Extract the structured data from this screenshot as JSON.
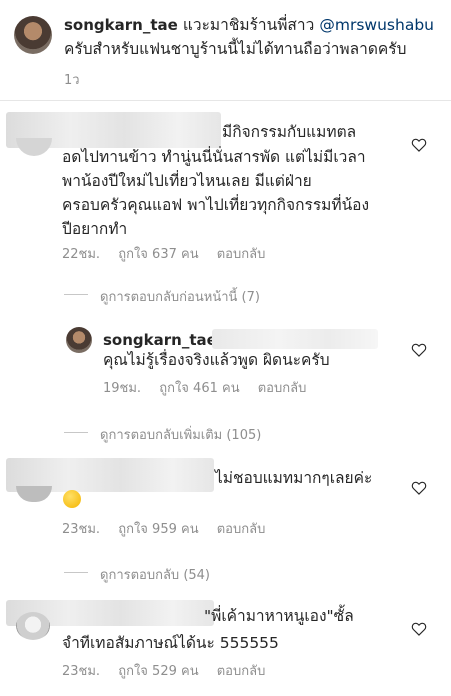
{
  "post": {
    "username": "songkarn_tae",
    "line1_prefix": "แวะมาชิมร้านพี่สาว",
    "mention": "@mrswushabu",
    "line2": "ครับสำหรับแฟนชาบูร้านนี้ไม่ได้ทานถือว่าพลาดครับ",
    "time": "1ว"
  },
  "comments": [
    {
      "lines": [
        "มีกิจกรรมกับแมทตล",
        "อดไปทานข้าว ทำนู่นนี่นั่นสารพัด แต่ไม่มีเวลา",
        "พาน้องปีใหม่ไปเที่ยวไหนเลย มีแต่ฝ่าย",
        "ครอบครัวคุณแอฟ พาไปเที่ยวทุกกิจกรรมที่น้อง",
        "ปีอยากทำ"
      ],
      "time": "22ชม.",
      "likes": "ถูกใจ 637 คน",
      "reply": "ตอบกลับ",
      "view_replies": "ดูการตอบกลับก่อนหน้านี้ (7)"
    },
    {
      "username": "songkarn_tae",
      "lines": [
        "คุณไม่รู้เรื่องจริงแล้วพูด ผิดนะครับ"
      ],
      "time": "19ชม.",
      "likes": "ถูกใจ 461 คน",
      "reply": "ตอบกลับ",
      "view_replies": "ดูการตอบกลับเพิ่มเติม (105)"
    },
    {
      "lines": [
        "ไม่ชอบแมทมากๆเลยค่ะ"
      ],
      "emoji": "😊",
      "time": "23ชม.",
      "likes": "ถูกใจ 959 คน",
      "reply": "ตอบกลับ",
      "view_replies": "ดูการตอบกลับ (54)"
    },
    {
      "lines": [
        "\"พี่เค้ามาหาหนูเอง\"ซั้ล",
        "จำทีเทอสัมภาษณ์ได้นะ 555555"
      ],
      "time": "23ชม.",
      "likes": "ถูกใจ 529 คน",
      "reply": "ตอบกลับ"
    }
  ],
  "icons": {
    "like": "heart-outline-icon"
  }
}
